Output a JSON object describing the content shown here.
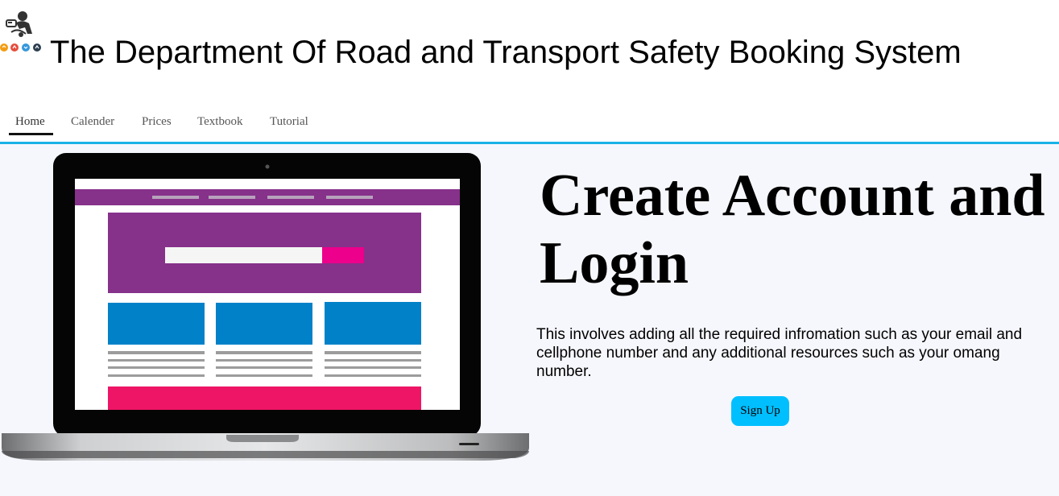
{
  "header": {
    "title": "The Department Of Road and Transport Safety Booking System",
    "logo_icon": "road-safety-logo-icon"
  },
  "nav": {
    "items": [
      {
        "label": "Home",
        "active": true
      },
      {
        "label": "Calender",
        "active": false
      },
      {
        "label": "Prices",
        "active": false
      },
      {
        "label": "Textbook",
        "active": false
      },
      {
        "label": "Tutorial",
        "active": false
      }
    ],
    "accent_color": "#1ab2e6"
  },
  "hero": {
    "heading": "Create Account and Login",
    "description": "This involves adding all the required infromation such as your email and cellphone number and any additional resources such as your omang number.",
    "signup_label": "Sign Up",
    "background_color": "#f6f7fc",
    "button_color": "#00bfff",
    "illustration_icon": "laptop-illustration-icon"
  }
}
